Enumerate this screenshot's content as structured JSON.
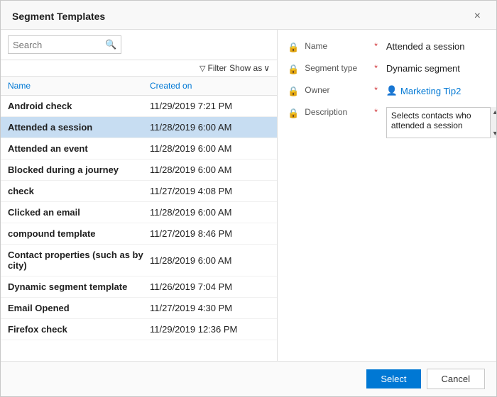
{
  "dialog": {
    "title": "Segment Templates",
    "close_label": "×"
  },
  "search": {
    "placeholder": "Search",
    "icon": "🔍"
  },
  "toolbar": {
    "filter_label": "Filter",
    "show_as_label": "Show as",
    "filter_icon": "▽",
    "chevron_icon": "∨"
  },
  "columns": {
    "name_label": "Name",
    "created_label": "Created on"
  },
  "list": [
    {
      "name": "Android check",
      "date": "11/29/2019 7:21 PM",
      "selected": false
    },
    {
      "name": "Attended a session",
      "date": "11/28/2019 6:00 AM",
      "selected": true
    },
    {
      "name": "Attended an event",
      "date": "11/28/2019 6:00 AM",
      "selected": false
    },
    {
      "name": "Blocked during a journey",
      "date": "11/28/2019 6:00 AM",
      "selected": false
    },
    {
      "name": "check",
      "date": "11/27/2019 4:08 PM",
      "selected": false
    },
    {
      "name": "Clicked an email",
      "date": "11/28/2019 6:00 AM",
      "selected": false
    },
    {
      "name": "compound template",
      "date": "11/27/2019 8:46 PM",
      "selected": false
    },
    {
      "name": "Contact properties (such as by city)",
      "date": "11/28/2019 6:00 AM",
      "selected": false
    },
    {
      "name": "Dynamic segment template",
      "date": "11/26/2019 7:04 PM",
      "selected": false
    },
    {
      "name": "Email Opened",
      "date": "11/27/2019 4:30 PM",
      "selected": false
    },
    {
      "name": "Firefox check",
      "date": "11/29/2019 12:36 PM",
      "selected": false
    }
  ],
  "detail": {
    "name_label": "Name",
    "name_value": "Attended a session",
    "segment_type_label": "Segment type",
    "segment_type_value": "Dynamic segment",
    "owner_label": "Owner",
    "owner_value": "Marketing Tip2",
    "description_label": "Description",
    "description_value": "Selects contacts who attended a session"
  },
  "footer": {
    "select_label": "Select",
    "cancel_label": "Cancel"
  }
}
